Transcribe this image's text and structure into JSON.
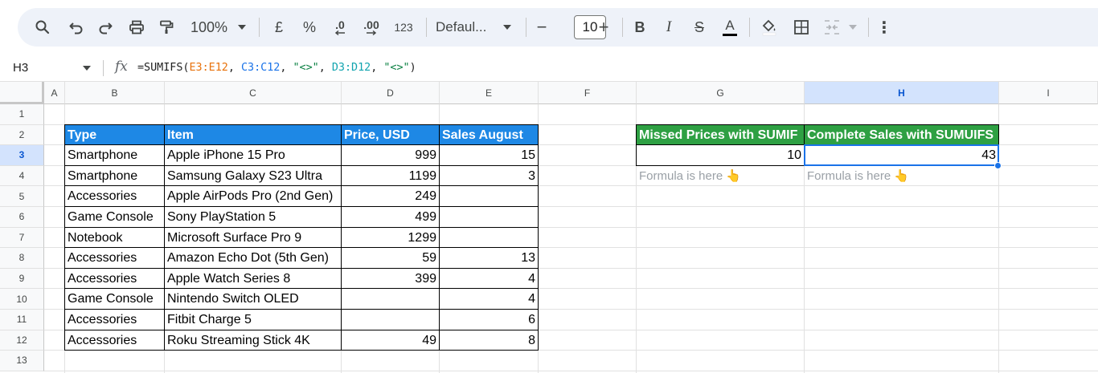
{
  "toolbar": {
    "zoom": "100%",
    "currency": "£",
    "percent": "%",
    "decrease_decimal": ".0",
    "increase_decimal": ".00",
    "number_format": "123",
    "font": "Defaul...",
    "font_size": "10",
    "bold": "B",
    "italic": "I",
    "strike": "S",
    "text_color": "A",
    "minus": "−",
    "plus": "+",
    "more": "⋮"
  },
  "formula_bar": {
    "cell_ref": "H3",
    "fx": "fx",
    "f_prefix": "=SUMIFS(",
    "f_range1": "E3:E12",
    "f_sep1": ", ",
    "f_range2": "C3:C12",
    "f_sep2": ", ",
    "f_crit1": "\"<>\"",
    "f_sep3": ", ",
    "f_range3": "D3:D12",
    "f_sep4": ", ",
    "f_crit2": "\"<>\"",
    "f_suffix": ")"
  },
  "columns": [
    "A",
    "B",
    "C",
    "D",
    "E",
    "F",
    "G",
    "H",
    "I"
  ],
  "rows": [
    "1",
    "2",
    "3",
    "4",
    "5",
    "6",
    "7",
    "8",
    "9",
    "10",
    "11",
    "12",
    "13"
  ],
  "table": {
    "headers": [
      "Type",
      "Item",
      "Price, USD",
      "Sales August"
    ],
    "rows": [
      [
        "Smartphone",
        "Apple iPhone 15 Pro",
        "999",
        "15"
      ],
      [
        "Smartphone",
        "Samsung Galaxy S23 Ultra",
        "1199",
        "3"
      ],
      [
        "Accessories",
        "Apple AirPods Pro (2nd Gen)",
        "249",
        ""
      ],
      [
        "Game Console",
        "Sony PlayStation 5",
        "499",
        ""
      ],
      [
        "Notebook",
        "Microsoft Surface Pro 9",
        "1299",
        ""
      ],
      [
        "Accessories",
        "Amazon Echo Dot (5th Gen)",
        "59",
        "13"
      ],
      [
        "Accessories",
        "Apple Watch Series 8",
        "399",
        "4"
      ],
      [
        "Game Console",
        "Nintendo Switch OLED",
        "",
        "4"
      ],
      [
        "Accessories",
        "Fitbit Charge 5",
        "",
        "6"
      ],
      [
        "Accessories",
        "Roku Streaming Stick 4K",
        "49",
        "8"
      ]
    ]
  },
  "results": {
    "g_header": "Missed Prices with SUMIF",
    "h_header": "Complete Sales with SUMUIFS",
    "g_value": "10",
    "h_value": "43",
    "g_hint": "Formula is here 👆",
    "h_hint": "Formula is here 👆"
  },
  "colors": {
    "table_header": "#1e88e5",
    "result_header": "#2ea043",
    "selection": "#1a73e8",
    "toolbar_bg": "#eef2f9"
  },
  "icons": [
    "search-icon",
    "undo-icon",
    "redo-icon",
    "print-icon",
    "paint-format-icon",
    "fill-color-icon",
    "borders-icon",
    "merge-cells-icon",
    "more-icon"
  ]
}
